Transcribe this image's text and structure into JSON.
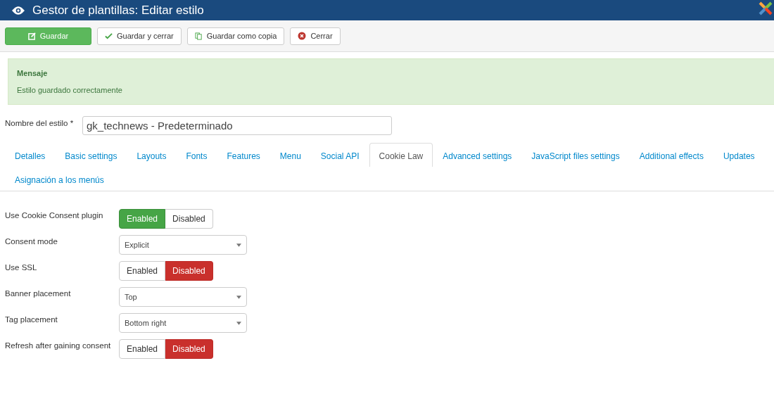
{
  "header": {
    "title": "Gestor de plantillas: Editar estilo"
  },
  "toolbar": [
    {
      "label": "Guardar",
      "kind": "save"
    },
    {
      "label": "Guardar y cerrar",
      "kind": "save_close"
    },
    {
      "label": "Guardar como copia",
      "kind": "save_copy"
    },
    {
      "label": "Cerrar",
      "kind": "close"
    }
  ],
  "message": {
    "heading": "Mensaje",
    "text": "Estilo guardado correctamente"
  },
  "style_name": {
    "label": "Nombre del estilo *",
    "value": "gk_technews - Predeterminado"
  },
  "tabs": [
    {
      "label": "Detalles",
      "selected": false
    },
    {
      "label": "Basic settings",
      "selected": false
    },
    {
      "label": "Layouts",
      "selected": false
    },
    {
      "label": "Fonts",
      "selected": false
    },
    {
      "label": "Features",
      "selected": false
    },
    {
      "label": "Menu",
      "selected": false
    },
    {
      "label": "Social API",
      "selected": false
    },
    {
      "label": "Cookie Law",
      "selected": true
    },
    {
      "label": "Advanced settings",
      "selected": false
    },
    {
      "label": "JavaScript files settings",
      "selected": false
    },
    {
      "label": "Additional effects",
      "selected": false
    },
    {
      "label": "Updates",
      "selected": false
    },
    {
      "label": "Asignación a los menús",
      "selected": false
    }
  ],
  "fields": [
    {
      "label": "Use Cookie Consent plugin",
      "kind": "toggle",
      "options": [
        {
          "label": "Enabled",
          "kind": "enabled",
          "selected": true
        },
        {
          "label": "Disabled",
          "kind": "disabled",
          "selected": false
        }
      ]
    },
    {
      "label": "Consent mode",
      "kind": "select",
      "value": "Explicit"
    },
    {
      "label": "Use SSL",
      "kind": "toggle",
      "options": [
        {
          "label": "Enabled",
          "kind": "enabled",
          "selected": false
        },
        {
          "label": "Disabled",
          "kind": "disabled",
          "selected": true
        }
      ]
    },
    {
      "label": "Banner placement",
      "kind": "select",
      "value": "Top"
    },
    {
      "label": "Tag placement",
      "kind": "select",
      "value": "Bottom right"
    },
    {
      "label": "Refresh after gaining consent",
      "kind": "toggle",
      "options": [
        {
          "label": "Enabled",
          "kind": "enabled",
          "selected": false
        },
        {
          "label": "Disabled",
          "kind": "disabled",
          "selected": true
        }
      ]
    }
  ]
}
